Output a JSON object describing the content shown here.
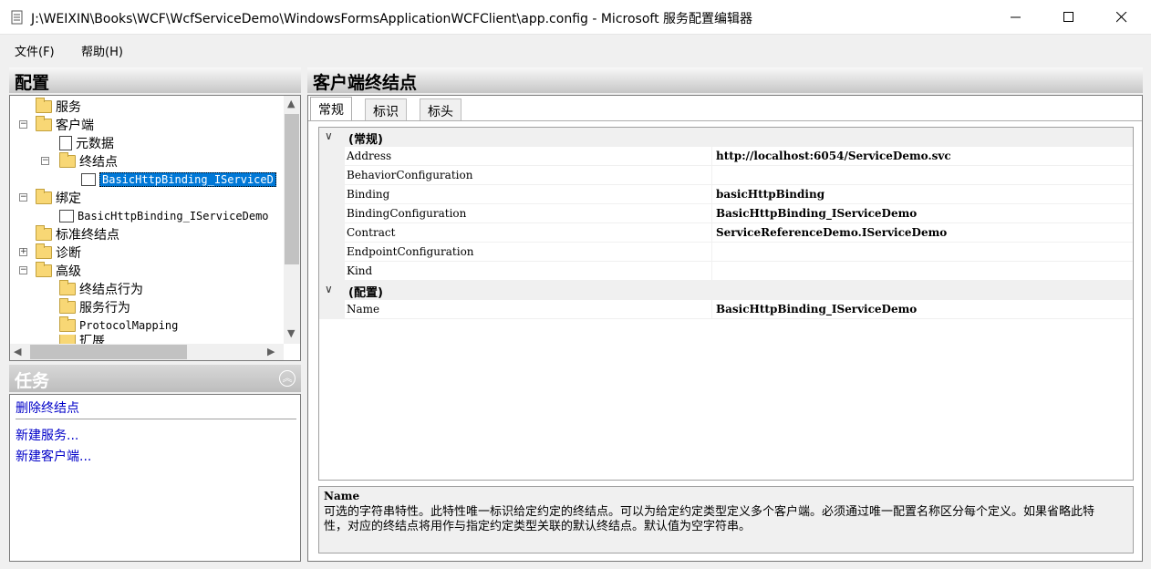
{
  "window": {
    "title": "J:\\WEIXIN\\Books\\WCF\\WcfServiceDemo\\WindowsFormsApplicationWCFClient\\app.config - Microsoft 服务配置编辑器",
    "icon": "config-editor-icon"
  },
  "menu": {
    "file": "文件(F)",
    "help": "帮助(H)"
  },
  "left": {
    "header": "配置",
    "tree": [
      {
        "label": "服务"
      },
      {
        "label": "客户端"
      },
      {
        "label": "元数据"
      },
      {
        "label": "终结点"
      },
      {
        "label": "BasicHttpBinding_IServiceD"
      },
      {
        "label": "绑定"
      },
      {
        "label": "BasicHttpBinding_IServiceDemo"
      },
      {
        "label": "标准终结点"
      },
      {
        "label": "诊断"
      },
      {
        "label": "高级"
      },
      {
        "label": "终结点行为"
      },
      {
        "label": "服务行为"
      },
      {
        "label": "ProtocolMapping"
      },
      {
        "label": "扩展"
      }
    ],
    "tasks_header": "任务",
    "tasks": [
      "删除终结点",
      "新建服务...",
      "新建客户端..."
    ]
  },
  "right": {
    "header": "客户端终结点",
    "tabs": [
      "常规",
      "标识",
      "标头"
    ],
    "categories": [
      "(常规)",
      "(配置)"
    ],
    "properties": [
      {
        "name": "Address",
        "value": "http://localhost:6054/ServiceDemo.svc"
      },
      {
        "name": "BehaviorConfiguration",
        "value": ""
      },
      {
        "name": "Binding",
        "value": "basicHttpBinding"
      },
      {
        "name": "BindingConfiguration",
        "value": "BasicHttpBinding_IServiceDemo"
      },
      {
        "name": "Contract",
        "value": "ServiceReferenceDemo.IServiceDemo"
      },
      {
        "name": "EndpointConfiguration",
        "value": ""
      },
      {
        "name": "Kind",
        "value": ""
      }
    ],
    "config_properties": [
      {
        "name": "Name",
        "value": "BasicHttpBinding_IServiceDemo"
      }
    ],
    "description": {
      "title": "Name",
      "text": "可选的字符串特性。此特性唯一标识给定约定的终结点。可以为给定约定类型定义多个客户端。必须通过唯一配置名称区分每个定义。如果省略此特性，对应的终结点将用作与指定约定类型关联的默认终结点。默认值为空字符串。"
    }
  }
}
